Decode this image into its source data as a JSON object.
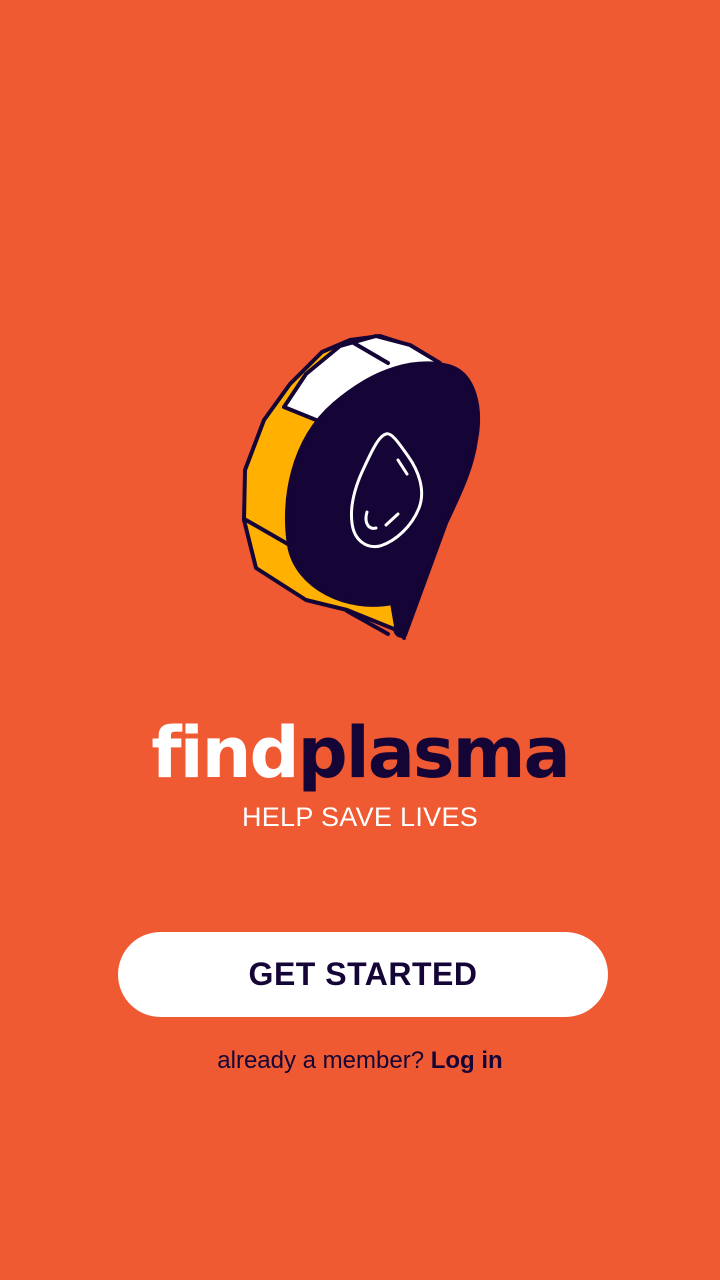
{
  "theme": {
    "background": "#F05A33",
    "primary_dark": "#140536",
    "accent_yellow": "#FFB000",
    "white": "#FFFFFF"
  },
  "logo": {
    "icon": "map-pin-blood-drop-icon",
    "wordmark_part1": "find",
    "wordmark_part2": "plasma"
  },
  "tagline": "HELP SAVE LIVES",
  "get_started": {
    "label": "GET STARTED"
  },
  "login_prompt": {
    "text": "already a member? ",
    "link_label": "Log in"
  }
}
